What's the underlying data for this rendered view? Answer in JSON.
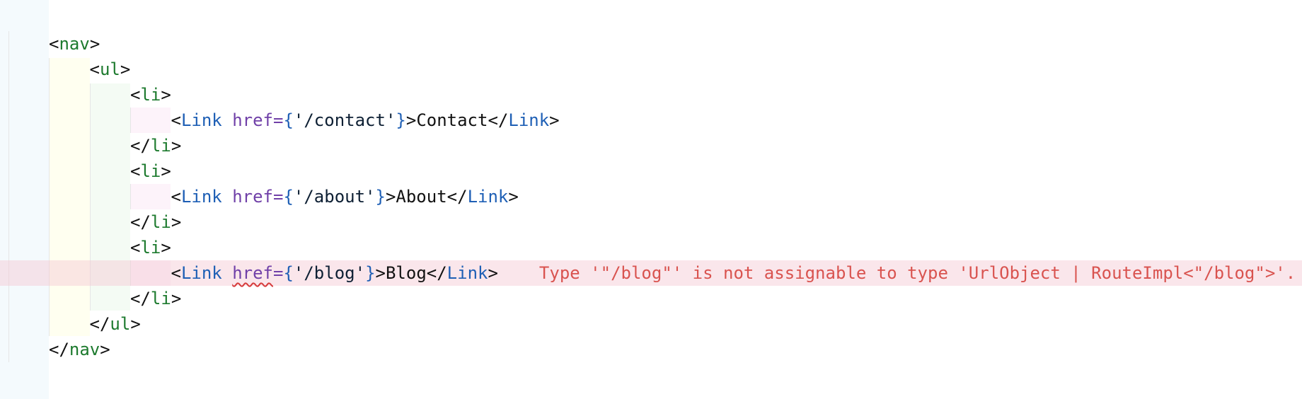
{
  "editor": {
    "lines": [
      {
        "indent": 0,
        "tokens": [
          {
            "t": "p",
            "v": "<"
          },
          {
            "t": "tag",
            "v": "nav"
          },
          {
            "t": "p",
            "v": ">"
          }
        ]
      },
      {
        "indent": 1,
        "tokens": [
          {
            "t": "p",
            "v": "<"
          },
          {
            "t": "tag",
            "v": "ul"
          },
          {
            "t": "p",
            "v": ">"
          }
        ]
      },
      {
        "indent": 2,
        "tokens": [
          {
            "t": "p",
            "v": "<"
          },
          {
            "t": "tag",
            "v": "li"
          },
          {
            "t": "p",
            "v": ">"
          }
        ]
      },
      {
        "indent": 3,
        "tokens": [
          {
            "t": "p",
            "v": "<"
          },
          {
            "t": "comp",
            "v": "Link"
          },
          {
            "t": "p",
            "v": " "
          },
          {
            "t": "attr",
            "v": "href="
          },
          {
            "t": "brace",
            "v": "{"
          },
          {
            "t": "str",
            "v": "'/contact'"
          },
          {
            "t": "brace",
            "v": "}"
          },
          {
            "t": "p",
            "v": ">"
          },
          {
            "t": "text",
            "v": "Contact"
          },
          {
            "t": "p",
            "v": "</"
          },
          {
            "t": "comp",
            "v": "Link"
          },
          {
            "t": "p",
            "v": ">"
          }
        ]
      },
      {
        "indent": 2,
        "tokens": [
          {
            "t": "p",
            "v": "</"
          },
          {
            "t": "tag",
            "v": "li"
          },
          {
            "t": "p",
            "v": ">"
          }
        ]
      },
      {
        "indent": 2,
        "tokens": [
          {
            "t": "p",
            "v": "<"
          },
          {
            "t": "tag",
            "v": "li"
          },
          {
            "t": "p",
            "v": ">"
          }
        ]
      },
      {
        "indent": 3,
        "tokens": [
          {
            "t": "p",
            "v": "<"
          },
          {
            "t": "comp",
            "v": "Link"
          },
          {
            "t": "p",
            "v": " "
          },
          {
            "t": "attr",
            "v": "href="
          },
          {
            "t": "brace",
            "v": "{"
          },
          {
            "t": "str",
            "v": "'/about'"
          },
          {
            "t": "brace",
            "v": "}"
          },
          {
            "t": "p",
            "v": ">"
          },
          {
            "t": "text",
            "v": "About"
          },
          {
            "t": "p",
            "v": "</"
          },
          {
            "t": "comp",
            "v": "Link"
          },
          {
            "t": "p",
            "v": ">"
          }
        ]
      },
      {
        "indent": 2,
        "tokens": [
          {
            "t": "p",
            "v": "</"
          },
          {
            "t": "tag",
            "v": "li"
          },
          {
            "t": "p",
            "v": ">"
          }
        ]
      },
      {
        "indent": 2,
        "tokens": [
          {
            "t": "p",
            "v": "<"
          },
          {
            "t": "tag",
            "v": "li"
          },
          {
            "t": "p",
            "v": ">"
          }
        ]
      },
      {
        "indent": 3,
        "error": true,
        "tokens": [
          {
            "t": "p",
            "v": "<"
          },
          {
            "t": "comp",
            "v": "Link"
          },
          {
            "t": "p",
            "v": " "
          },
          {
            "t": "attr",
            "v": "href",
            "squiggle": true
          },
          {
            "t": "attr",
            "v": "="
          },
          {
            "t": "brace",
            "v": "{"
          },
          {
            "t": "str",
            "v": "'/blog'"
          },
          {
            "t": "brace",
            "v": "}"
          },
          {
            "t": "p",
            "v": ">"
          },
          {
            "t": "text",
            "v": "Blog"
          },
          {
            "t": "p",
            "v": "</"
          },
          {
            "t": "comp",
            "v": "Link"
          },
          {
            "t": "p",
            "v": ">"
          }
        ]
      },
      {
        "indent": 2,
        "tokens": [
          {
            "t": "p",
            "v": "</"
          },
          {
            "t": "tag",
            "v": "li"
          },
          {
            "t": "p",
            "v": ">"
          }
        ]
      },
      {
        "indent": 1,
        "tokens": [
          {
            "t": "p",
            "v": "</"
          },
          {
            "t": "tag",
            "v": "ul"
          },
          {
            "t": "p",
            "v": ">"
          }
        ]
      },
      {
        "indent": 0,
        "tokens": [
          {
            "t": "p",
            "v": "</"
          },
          {
            "t": "tag",
            "v": "nav"
          },
          {
            "t": "p",
            "v": ">"
          }
        ]
      }
    ],
    "diagnostic": {
      "line": 9,
      "message": "Type '\"/blog\"' is not assignable to type 'UrlObject | RouteImpl<\"/blog\">'."
    },
    "colors": {
      "tag": "#1d7a2e",
      "component": "#1e5fb5",
      "attribute": "#7040a8",
      "error": "#d9534f",
      "error_line_bg": "#f9e1e7"
    }
  }
}
